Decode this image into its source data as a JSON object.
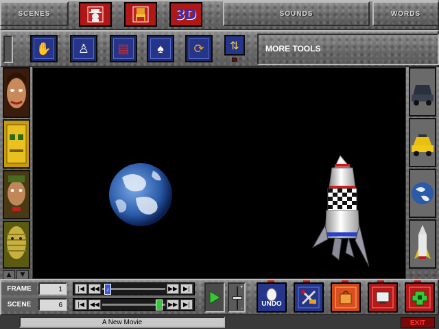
{
  "top_tabs": {
    "scenes": "SCENES",
    "sounds": "SOUNDS",
    "words": "WORDS"
  },
  "category_buttons": [
    {
      "icon": "actor-hat-icon",
      "color": "#b01818"
    },
    {
      "icon": "prop-chair-icon",
      "color": "#b01818"
    },
    {
      "icon": "3d-text-icon",
      "label": "3D",
      "color": "#2a2aa0"
    }
  ],
  "tools": [
    {
      "icon": "hand-icon",
      "glyph": "✋"
    },
    {
      "icon": "actor-walk-icon",
      "glyph": "♙"
    },
    {
      "icon": "film-frames-icon",
      "glyph": "▤"
    },
    {
      "icon": "costume-shirt-icon",
      "glyph": "♠"
    },
    {
      "icon": "rotate-box-icon",
      "glyph": "⟳"
    }
  ],
  "more_tools_label": "MORE TOOLS",
  "controls": {
    "frame_label": "FRAME",
    "frame_value": "1",
    "scene_label": "SCENE",
    "scene_value": "6"
  },
  "undo_label": "UNDO",
  "status_title": "A New Movie",
  "exit_label": "EXIT",
  "left_thumbs": [
    "actor-woman-face-icon",
    "actor-robot-icon",
    "actor-bearded-man-icon",
    "actor-mummy-icon"
  ],
  "right_thumbs": [
    "prop-car-icon",
    "prop-taxi-icon",
    "prop-earth-icon",
    "prop-rocket-icon"
  ],
  "colors": {
    "stage_bg": "#000000",
    "tool_blue": "#24358a",
    "accent_red": "#b01818",
    "play_green": "#39c43a"
  }
}
